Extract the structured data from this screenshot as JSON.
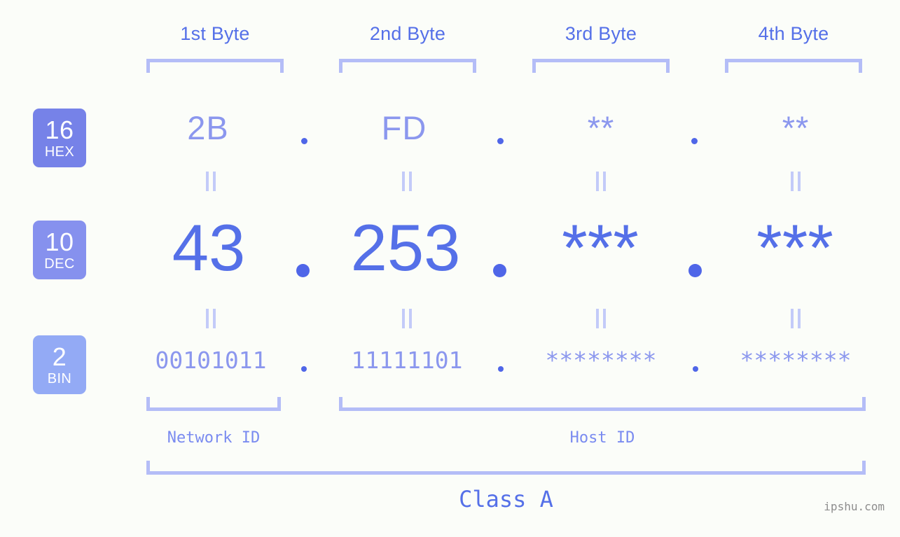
{
  "watermark": "ipshu.com",
  "byte_headers": [
    {
      "label": "1st Byte"
    },
    {
      "label": "2nd Byte"
    },
    {
      "label": "3rd Byte"
    },
    {
      "label": "4th Byte"
    }
  ],
  "rows": [
    {
      "id": "hex",
      "badge_number": "16",
      "badge_label": "HEX",
      "badge_color": "#7682e8",
      "values": [
        "2B",
        "FD",
        "**",
        "**"
      ]
    },
    {
      "id": "dec",
      "badge_number": "10",
      "badge_label": "DEC",
      "badge_color": "#8691ee",
      "values": [
        "43",
        "253",
        "***",
        "***"
      ]
    },
    {
      "id": "bin",
      "badge_number": "2",
      "badge_label": "BIN",
      "badge_color": "#93aaf5",
      "values": [
        "00101011",
        "11111101",
        "********",
        "********"
      ]
    }
  ],
  "separators": {
    "dot": "."
  },
  "equals_marker": "=",
  "footer": {
    "network_id_label": "Network ID",
    "host_id_label": "Host ID",
    "class_label": "Class A"
  },
  "colors": {
    "background": "#fbfdf9",
    "accent_strong": "#5570e8",
    "accent_light": "#8b97ee",
    "bracket": "#b4bdf7",
    "dot": "#4f66e8",
    "equals": "#c3cbf9",
    "watermark": "#8d8d8d"
  }
}
